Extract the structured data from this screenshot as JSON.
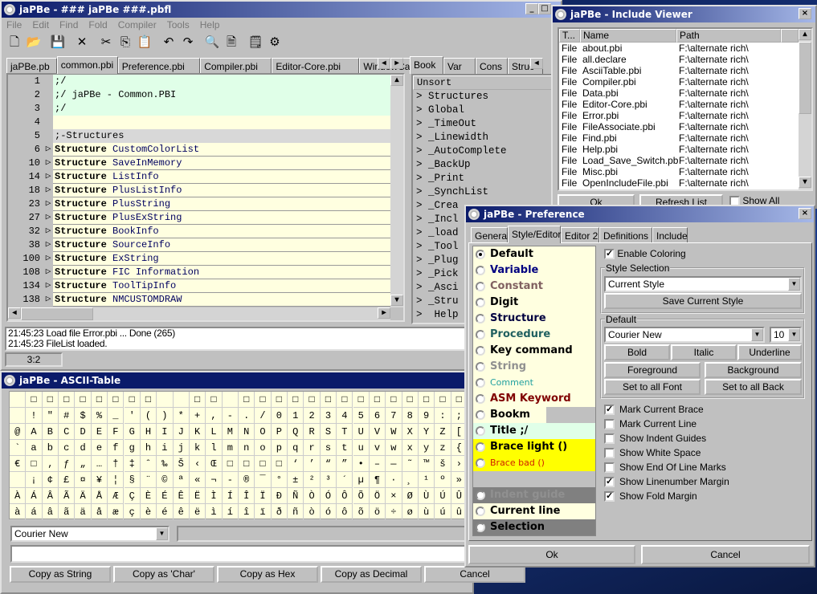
{
  "main": {
    "title": "jaPBe - ### jaPBe ###.pbfl",
    "menu": [
      "File",
      "Edit",
      "Find",
      "Fold",
      "Compiler",
      "Tools",
      "Help"
    ],
    "toolbar": [
      "new-file",
      "open-folder",
      "save",
      "close",
      "cut",
      "copy",
      "paste",
      "undo",
      "redo",
      "find",
      "find-next",
      "properties",
      "settings"
    ],
    "file_tabs": [
      "jaPBe.pb",
      "common.pbi",
      "Preference.pbi",
      "Compiler.pbi",
      "Editor-Core.pbi",
      "WindowCallback.pbi"
    ],
    "active_file_tab": 1,
    "code_lines": [
      {
        "n": "1",
        "t": ";/",
        "style": "title"
      },
      {
        "n": "2",
        "t": ";/ jaPBe - Common.PBI",
        "style": "title"
      },
      {
        "n": "3",
        "t": ";/",
        "style": "title"
      },
      {
        "n": "4",
        "t": "",
        "style": "current"
      },
      {
        "n": "5",
        "t": ";-Structures",
        "style": "bookmark"
      },
      {
        "n": "6",
        "kw": "Structure",
        "t": "CustomColorList"
      },
      {
        "n": "10",
        "kw": "Structure",
        "t": "SaveInMemory"
      },
      {
        "n": "14",
        "kw": "Structure",
        "t": "ListInfo"
      },
      {
        "n": "18",
        "kw": "Structure",
        "t": "PlusListInfo"
      },
      {
        "n": "23",
        "kw": "Structure",
        "t": "PlusString"
      },
      {
        "n": "27",
        "kw": "Structure",
        "t": "PlusExString"
      },
      {
        "n": "32",
        "kw": "Structure",
        "t": "BookInfo"
      },
      {
        "n": "38",
        "kw": "Structure",
        "t": "SourceInfo"
      },
      {
        "n": "100",
        "kw": "Structure",
        "t": "ExString"
      },
      {
        "n": "108",
        "kw": "Structure",
        "t": "FIC Information"
      },
      {
        "n": "134",
        "kw": "Structure",
        "t": "ToolTipInfo"
      },
      {
        "n": "138",
        "kw": "Structure",
        "t": "NMCUSTOMDRAW"
      }
    ],
    "side_tabs": [
      "Book",
      "Var",
      "Cons",
      "Struc"
    ],
    "side_header": "Unsort",
    "bookmarks": [
      "Structures",
      "Global",
      "_TimeOut",
      "_Linewidth",
      "_AutoComplete",
      "_BackUp",
      "_Print",
      "_SynchList",
      "_Crea",
      "_Incl",
      "_load",
      "_Tool",
      "_Plug",
      "_Pick",
      "_Asci",
      "_Stru",
      " Help"
    ],
    "log": [
      "21:45:23  Load file Error.pbi ... Done (265)",
      "21:45:23  FileList loaded."
    ],
    "status": "3:2"
  },
  "include_viewer": {
    "title": "jaPBe - Include Viewer",
    "columns": [
      "T...",
      "Name",
      "Path"
    ],
    "rows": [
      [
        "File",
        "about.pbi",
        "F:\\alternate rich\\"
      ],
      [
        "File",
        "all.declare",
        "F:\\alternate rich\\"
      ],
      [
        "File",
        "AsciiTable.pbi",
        "F:\\alternate rich\\"
      ],
      [
        "File",
        "Compiler.pbi",
        "F:\\alternate rich\\"
      ],
      [
        "File",
        "Data.pbi",
        "F:\\alternate rich\\"
      ],
      [
        "File",
        "Editor-Core.pbi",
        "F:\\alternate rich\\"
      ],
      [
        "File",
        "Error.pbi",
        "F:\\alternate rich\\"
      ],
      [
        "File",
        "FileAssociate.pbi",
        "F:\\alternate rich\\"
      ],
      [
        "File",
        "Find.pbi",
        "F:\\alternate rich\\"
      ],
      [
        "File",
        "Help.pbi",
        "F:\\alternate rich\\"
      ],
      [
        "File",
        "Load_Save_Switch.pbi",
        "F:\\alternate rich\\"
      ],
      [
        "File",
        "Misc.pbi",
        "F:\\alternate rich\\"
      ],
      [
        "File",
        "OpenIncludeFile.pbi",
        "F:\\alternate rich\\"
      ]
    ],
    "ok": "Ok",
    "refresh": "Refresh List",
    "show_all": "Show All",
    "show_all_checked": false
  },
  "ascii": {
    "title": "jaPBe - ASCII-Table",
    "rows": [
      [
        "",
        "□",
        "□",
        "□",
        "□",
        "□",
        "□",
        "□",
        "□",
        "",
        "",
        "□",
        "□",
        "",
        "□",
        "□",
        "□",
        "□",
        "□",
        "□",
        "□",
        "□",
        "□",
        "□",
        "□",
        "□",
        "□",
        "□"
      ],
      [
        "",
        "!",
        "\"",
        "#",
        "$",
        "%",
        "_",
        "'",
        "(",
        ")",
        "*",
        "+",
        ",",
        "-",
        ".",
        "/",
        "0",
        "1",
        "2",
        "3",
        "4",
        "5",
        "6",
        "7",
        "8",
        "9",
        ":",
        ";"
      ],
      [
        "@",
        "A",
        "B",
        "C",
        "D",
        "E",
        "F",
        "G",
        "H",
        "I",
        "J",
        "K",
        "L",
        "M",
        "N",
        "O",
        "P",
        "Q",
        "R",
        "S",
        "T",
        "U",
        "V",
        "W",
        "X",
        "Y",
        "Z",
        "["
      ],
      [
        "`",
        "a",
        "b",
        "c",
        "d",
        "e",
        "f",
        "g",
        "h",
        "i",
        "j",
        "k",
        "l",
        "m",
        "n",
        "o",
        "p",
        "q",
        "r",
        "s",
        "t",
        "u",
        "v",
        "w",
        "x",
        "y",
        "z",
        "{"
      ],
      [
        "€",
        "□",
        "‚",
        "ƒ",
        "„",
        "…",
        "†",
        "‡",
        "ˆ",
        "‰",
        "Š",
        "‹",
        "Œ",
        "□",
        "□",
        "□",
        "□",
        "‘",
        "’",
        "“",
        "”",
        "•",
        "–",
        "—",
        "˜",
        "™",
        "š",
        "›"
      ],
      [
        "",
        "¡",
        "¢",
        "£",
        "¤",
        "¥",
        "¦",
        "§",
        "¨",
        "©",
        "ª",
        "«",
        "¬",
        "-",
        "®",
        "¯",
        "°",
        "±",
        "²",
        "³",
        "´",
        "µ",
        "¶",
        "·",
        "¸",
        "¹",
        "º",
        "»"
      ],
      [
        "À",
        "Á",
        "Â",
        "Ã",
        "Ä",
        "Å",
        "Æ",
        "Ç",
        "È",
        "É",
        "Ê",
        "Ë",
        "Ì",
        "Í",
        "Î",
        "Ï",
        "Ð",
        "Ñ",
        "Ò",
        "Ó",
        "Ô",
        "Õ",
        "Ö",
        "×",
        "Ø",
        "Ù",
        "Ú",
        "Û"
      ],
      [
        "à",
        "á",
        "â",
        "ã",
        "ä",
        "å",
        "æ",
        "ç",
        "è",
        "é",
        "ê",
        "ë",
        "ì",
        "í",
        "î",
        "ï",
        "ð",
        "ñ",
        "ò",
        "ó",
        "ô",
        "õ",
        "ö",
        "÷",
        "ø",
        "ù",
        "ú",
        "û"
      ]
    ],
    "font": "Courier New",
    "input": "",
    "buttons": [
      "Copy as String",
      "Copy as 'Char'",
      "Copy as Hex",
      "Copy as Decimal",
      "Cancel"
    ]
  },
  "preference": {
    "title": "jaPBe - Preference",
    "tabs": [
      "General",
      "Style/Editor",
      "Editor 2",
      "Definitions",
      "Include"
    ],
    "active_tab": 1,
    "styles": [
      {
        "label": "Default",
        "color": "#000000",
        "bg": "#ffffe0",
        "bold": true,
        "selected": true
      },
      {
        "label": "Variable",
        "color": "#000080",
        "bg": "#ffffe0",
        "bold": true
      },
      {
        "label": "Constant",
        "color": "#806060",
        "bg": "#ffffe0",
        "bold": true
      },
      {
        "label": "Digit",
        "color": "#000000",
        "bg": "#ffffe0",
        "bold": true
      },
      {
        "label": "Structure",
        "color": "#000040",
        "bg": "#ffffe0",
        "bold": true
      },
      {
        "label": "Procedure",
        "color": "#206060",
        "bg": "#ffffe0",
        "bold": true
      },
      {
        "label": "Key command",
        "color": "#000000",
        "bg": "#ffffe0",
        "bold": true
      },
      {
        "label": "String",
        "color": "#909090",
        "bg": "#ffffe0",
        "bold": true
      },
      {
        "label": "Comment",
        "color": "#20a0a0",
        "bg": "#ffffe0",
        "bold": false
      },
      {
        "label": "ASM Keyword",
        "color": "#800000",
        "bg": "#ffffe0",
        "bold": true
      },
      {
        "label": "Bookm",
        "color": "#000000",
        "bg": "#c0c0c0",
        "bold": true
      },
      {
        "label": "Title ;/",
        "color": "#000000",
        "bg": "#e0ffe8",
        "bold": true
      },
      {
        "label": "Brace light ()",
        "color": "#000000",
        "bg": "#ffff00",
        "bold": true
      },
      {
        "label": "Brace bad ()",
        "color": "#d02000",
        "bg": "#ffff00",
        "bold": false
      },
      {
        "label": "",
        "color": "#000000",
        "bg": "#c0c0c0",
        "bold": false,
        "blank": true
      },
      {
        "label": "Indent guide",
        "color": "#909090",
        "bg": "#808080",
        "bold": true
      },
      {
        "label": "Current line",
        "color": "#000000",
        "bg": "#ffffe0",
        "bold": true
      },
      {
        "label": "Selection",
        "color": "#000000",
        "bg": "#808080",
        "bold": true
      }
    ],
    "enable_coloring": "Enable Coloring",
    "enable_coloring_checked": true,
    "style_selection_label": "Style Selection",
    "style_selection": "Current Style",
    "save_style": "Save Current Style",
    "default_label": "Default",
    "font": "Courier New",
    "size": "10",
    "bold": "Bold",
    "italic": "Italic",
    "underline": "Underline",
    "foreground": "Foreground",
    "background": "Background",
    "set_all_font": "Set to all Font",
    "set_all_back": "Set to all Back",
    "options": [
      {
        "label": "Mark Current Brace",
        "checked": true
      },
      {
        "label": "Mark Current Line",
        "checked": false
      },
      {
        "label": "Show Indent Guides",
        "checked": false
      },
      {
        "label": "Show White Space",
        "checked": false
      },
      {
        "label": "Show End Of Line Marks",
        "checked": false
      },
      {
        "label": "Show Linenumber Margin",
        "checked": true
      },
      {
        "label": "Show Fold Margin",
        "checked": true
      }
    ],
    "ok": "Ok",
    "cancel": "Cancel"
  },
  "colors": {
    "title_bar": "#0a1a6a",
    "editor_bg": "#ffffe0",
    "title_line_bg": "#e0ffe8",
    "bookmark_bg": "#d8d8d8"
  }
}
